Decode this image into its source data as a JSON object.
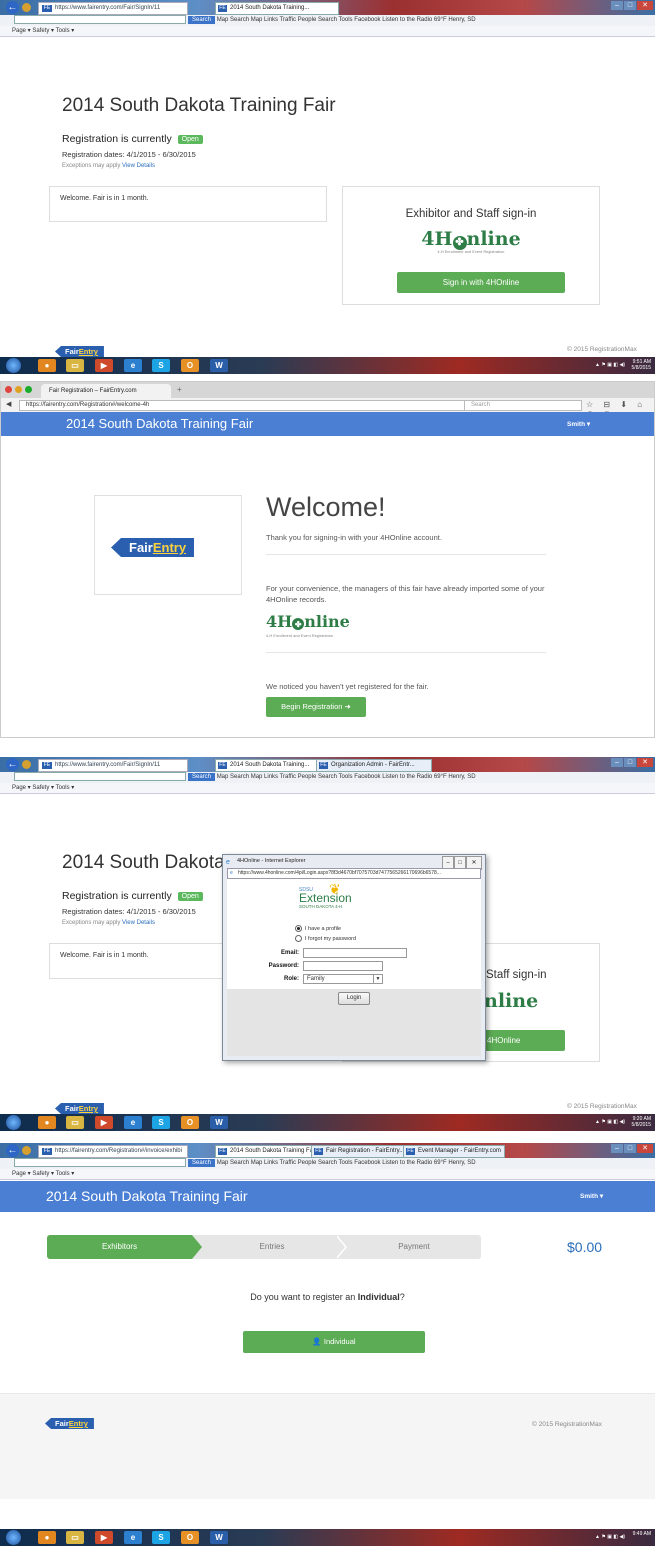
{
  "ie1": {
    "address": "https://www.fairentry.com/Fair/SignIn/11",
    "tabs": [
      "2014 South Dakota Training..."
    ],
    "toolbar_search_label": "Search",
    "toolbar_items": "Map Search   Map Links   Traffic   People Search   Tools   Facebook   Listen to the Radio   69°F Henry, SD",
    "command_bar": "Page ▾   Safety ▾   Tools ▾",
    "clock_time": "9:51 AM",
    "clock_date": "5/8/2015"
  },
  "s1": {
    "title": "2014 South Dakota Training Fair",
    "registration_label": "Registration is currently",
    "badge": "Open",
    "dates": "Registration dates: 4/1/2015 - 6/30/2015",
    "exceptions": "Exceptions may apply",
    "view_details": "View Details",
    "welcome": "Welcome. Fair is in 1 month.",
    "signin_title": "Exhibitor and Staff sign-in",
    "logo_text": "4H",
    "logo_text_b": "nline",
    "logo_sub": "4-H Enrollment and Event Registration",
    "signin_button": "Sign in with 4HOnline",
    "copyright": "© 2015 RegistrationMax",
    "fe_tag_a": "Fair",
    "fe_tag_b": "Entry"
  },
  "ff": {
    "tab": "Fair Registration – FairEntry.com",
    "url": "https://fairentry.com/Registration#/welcome-4h",
    "search_placeholder": "Search"
  },
  "s2": {
    "nav_title": "2014 South Dakota Training Fair",
    "user": "Smith ▾",
    "logo_a": "Fair",
    "logo_b": "Entry",
    "heading": "Welcome!",
    "thanks": "Thank you for signing-in with your 4HOnline account.",
    "convenience": "For your convenience, the managers of this fair have already imported some of your 4HOnline records.",
    "logo_text": "4H",
    "logo_text_b": "nline",
    "logo_sub": "4-H Enrollment and Event Registration",
    "not_registered": "We noticed you haven't yet registered for the fair.",
    "begin_button": "Begin Registration"
  },
  "ie3": {
    "address": "https://www.fairentry.com/Fair/SignIn/11",
    "tabs": [
      "2014 South Dakota Training...",
      "Organization Admin - FairEntr..."
    ],
    "clock_time": "9:20 AM",
    "clock_date": "5/8/2015"
  },
  "s3": {
    "title": "2014 South Dakota",
    "registration_label": "Registration is currently",
    "badge": "Open",
    "dates": "Registration dates: 4/1/2015 - 6/30/2015",
    "exceptions": "Exceptions may apply",
    "view_details": "View Details",
    "welcome": "Welcome. Fair is in 1 month.",
    "signin_partial": "Staff sign-in",
    "logo_partial": "nline",
    "button_partial": "4HOnline",
    "copyright": "© 2015 RegistrationMax",
    "popup": {
      "title": "4HOnline - Internet Explorer",
      "url": "https://www.4honline.com/4pi/Login.aspx?8f3d4670bf7075703d7477565266170696b6578...",
      "sdsu": "SDSU",
      "extension": "Extension",
      "state": "SOUTH DAKOTA 4-H",
      "radio_profile": "I have a profile",
      "radio_forgot": "I forgot my password",
      "email_label": "Email:",
      "password_label": "Password:",
      "role_label": "Role:",
      "role_value": "Family",
      "login_button": "Login"
    }
  },
  "ie4": {
    "address": "https://fairentry.com/Registration#/invoice/exhibi",
    "tabs": [
      "2014 South Dakota Training Fai...",
      "Fair Registration - FairEntry...",
      "Event Manager - FairEntry.com"
    ],
    "clock_time": "9:49 AM",
    "clock_date": ""
  },
  "s4": {
    "nav_title": "2014 South Dakota Training Fair",
    "user": "Smith ▾",
    "steps": [
      "Exhibitors",
      "Entries",
      "Payment"
    ],
    "total": "$0.00",
    "question_pre": "Do you want to register an ",
    "question_bold": "Individual",
    "question_post": "?",
    "individual_button": "Individual",
    "copyright": "© 2015 RegistrationMax",
    "fe_tag_a": "Fair",
    "fe_tag_b": "Entry"
  },
  "colors": {
    "accent_blue": "#4a7fd4",
    "green": "#5cab55",
    "brand_blue": "#2a5fb0",
    "brand_yellow": "#ffd23a",
    "fourh_green": "#2e7d47"
  }
}
